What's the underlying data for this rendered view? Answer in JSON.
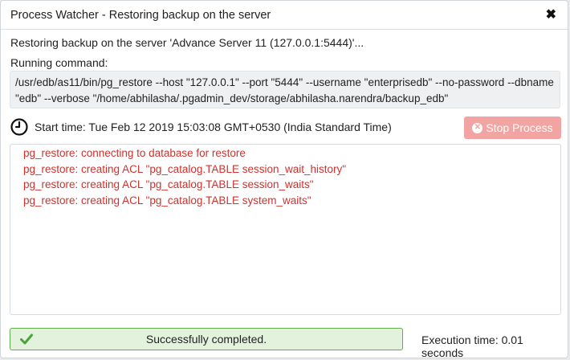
{
  "window": {
    "title": "Process Watcher - Restoring backup on the server",
    "close_label": "✖"
  },
  "process": {
    "description": "Restoring backup on the server 'Advance Server 11 (127.0.0.1:5444)'...",
    "running_label": "Running command:",
    "command": "/usr/edb/as11/bin/pg_restore --host \"127.0.0.1\" --port \"5444\" --username \"enterprisedb\" --no-password --dbname \"edb\" --verbose \"/home/abhilasha/.pgadmin_dev/storage/abhilasha.narendra/backup_edb\"",
    "start_time": "Start time: Tue Feb 12 2019 15:03:08 GMT+0530 (India Standard Time)"
  },
  "stop_button": {
    "label": "Stop Process",
    "icon": "times-circle-icon",
    "color": "#f1a4a2"
  },
  "log": {
    "lines": [
      "pg_restore: connecting to database for restore",
      "pg_restore: creating ACL \"pg_catalog.TABLE session_wait_history\"",
      "pg_restore: creating ACL \"pg_catalog.TABLE session_waits\"",
      "pg_restore: creating ACL \"pg_catalog.TABLE system_waits\""
    ],
    "color": "#d0312d"
  },
  "status": {
    "message": "Successfully completed.",
    "icon": "check-icon",
    "color": "#5fb04a",
    "background": "#e3f2dc"
  },
  "execution": {
    "text": "Execution time: 0.01 seconds"
  }
}
